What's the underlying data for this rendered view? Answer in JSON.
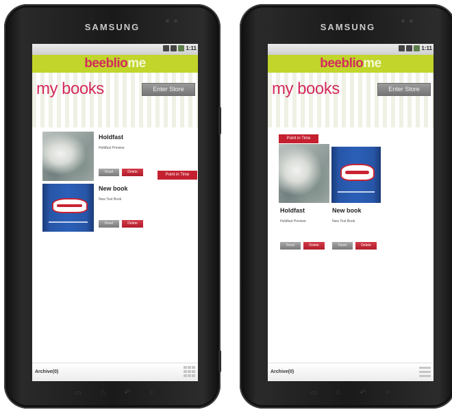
{
  "tablets": [
    {
      "brand": "SAMSUNG",
      "status": {
        "time": "1:11"
      },
      "app": {
        "logo_left": "beeblio",
        "logo_right": "me"
      },
      "page": {
        "title": "my books",
        "store_button": "Enter Store"
      },
      "books": [
        {
          "title": "Holdfast",
          "subtitle": "Holdfast Preview",
          "read_button": "Read",
          "delete_button": "Delete",
          "action_button": "Point in Time"
        },
        {
          "title": "New book",
          "subtitle": "New Test Book",
          "read_button": "Read",
          "delete_button": "Delete"
        }
      ],
      "footer": {
        "archive_label": "Archive(0)",
        "view_toggle_icon": "grid-view-icon"
      }
    },
    {
      "brand": "SAMSUNG",
      "status": {
        "time": "1:11"
      },
      "app": {
        "logo_left": "beeblio",
        "logo_right": "me"
      },
      "page": {
        "title": "my books",
        "store_button": "Enter Store"
      },
      "point_in_time_tab": "Point in Time",
      "books": [
        {
          "title": "Holdfast",
          "subtitle": "Holdfast Preview",
          "read_button": "Read",
          "delete_button": "Delete"
        },
        {
          "title": "New book",
          "subtitle": "New Test Book",
          "read_button": "Read",
          "delete_button": "Delete"
        }
      ],
      "footer": {
        "archive_label": "Archive(0)",
        "view_toggle_icon": "list-view-icon"
      }
    }
  ],
  "colors": {
    "accent_green": "#c1d52b",
    "brand_pink": "#d42b5e",
    "delete_red": "#c4202f"
  },
  "hardware_keys": [
    "menu-key-icon",
    "home-key-icon",
    "back-key-icon",
    "search-key-icon"
  ]
}
